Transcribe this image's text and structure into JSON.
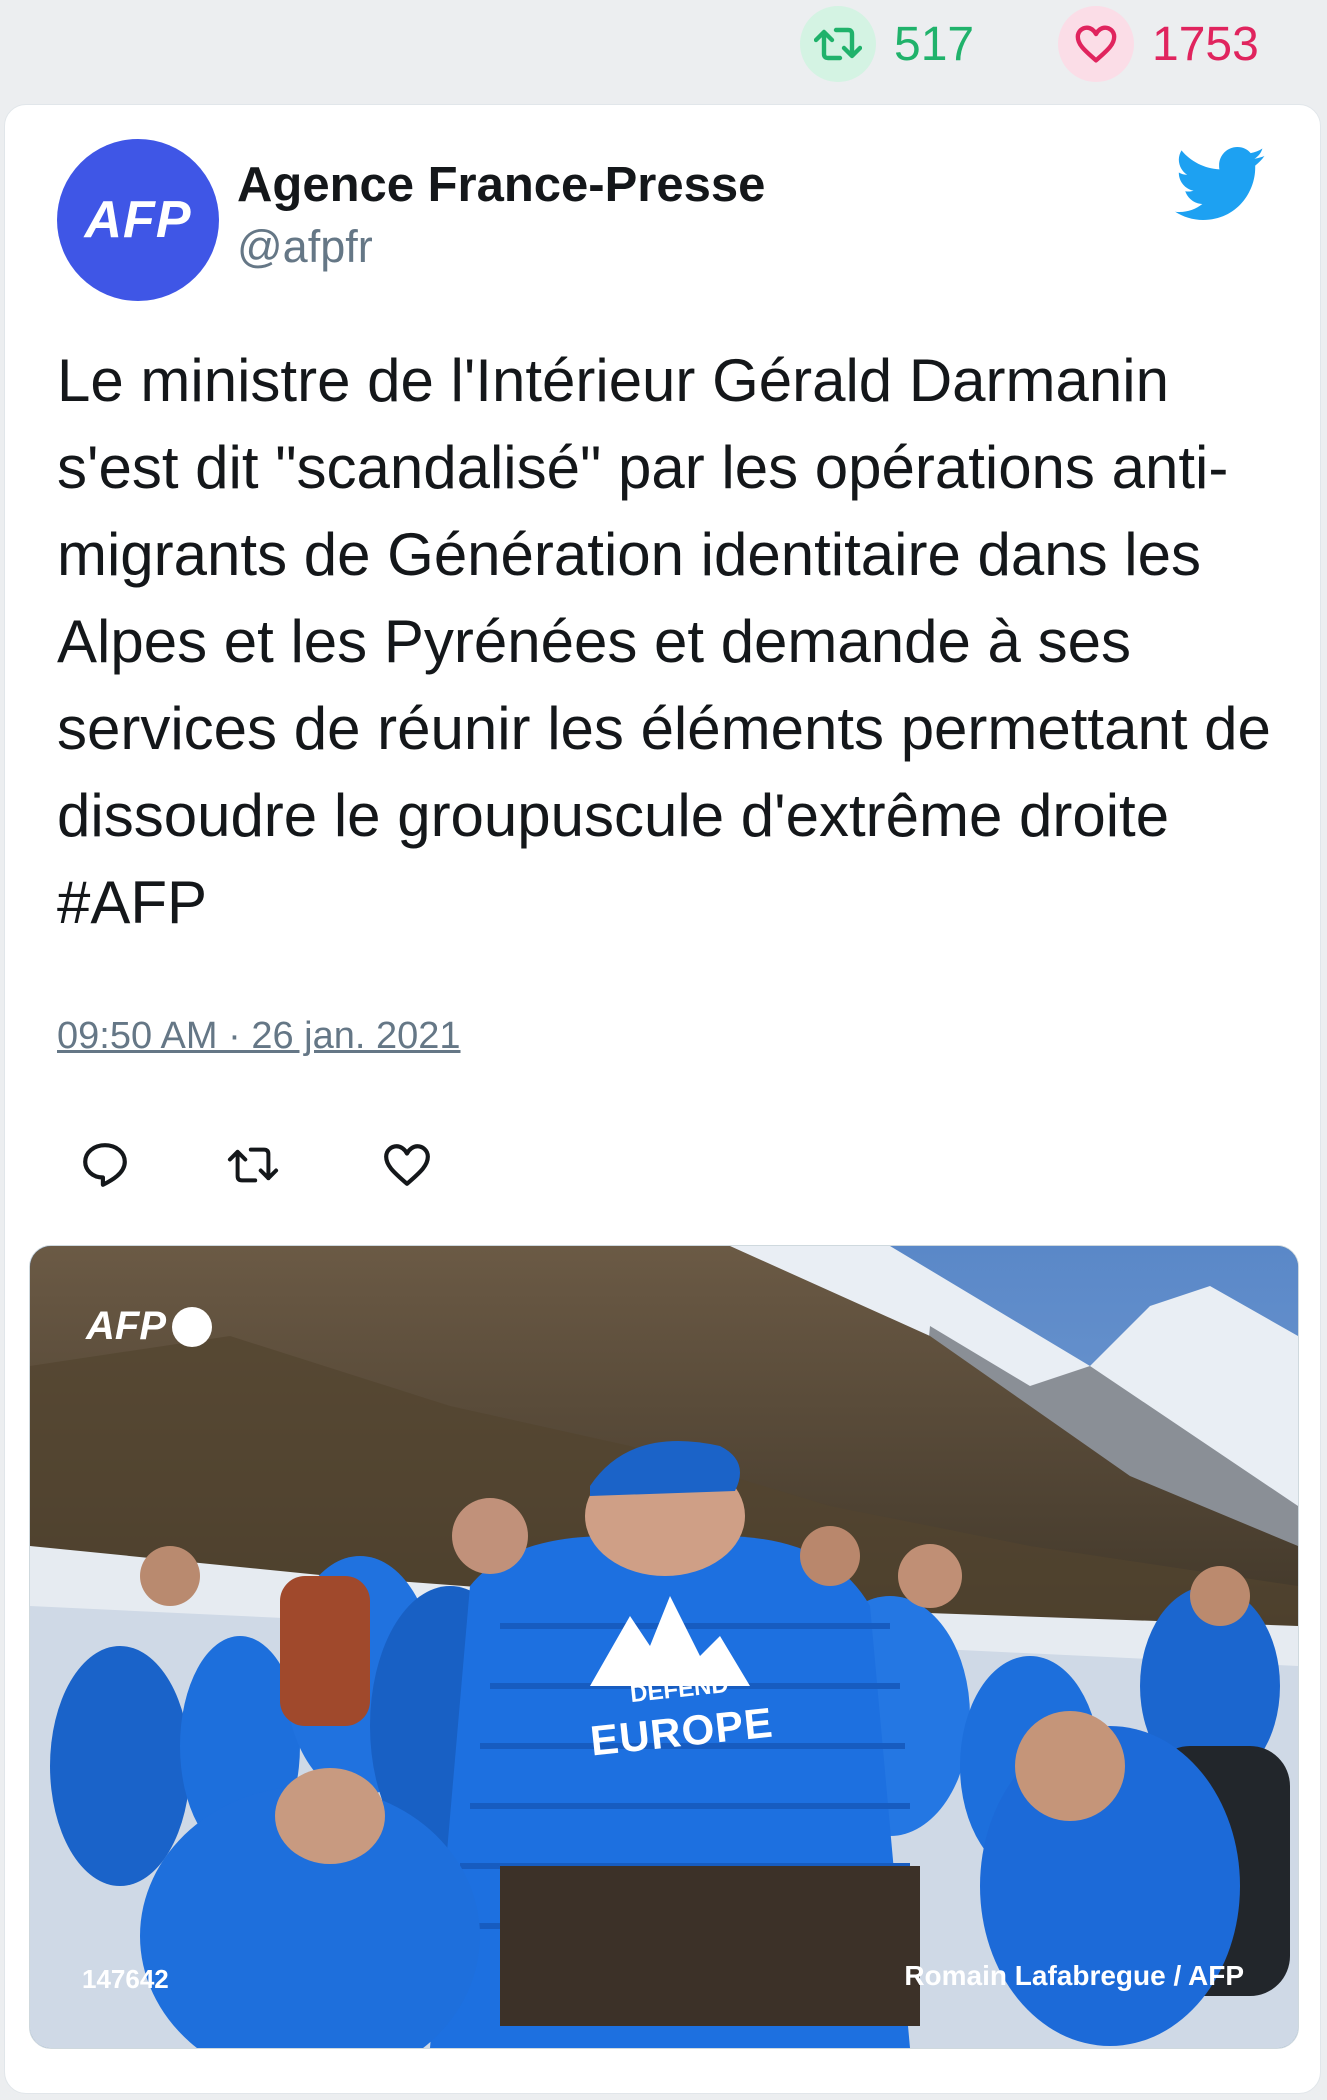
{
  "stats": {
    "retweet_count": "517",
    "like_count": "1753",
    "retweet_icon": "retweet-icon",
    "like_icon": "heart-icon"
  },
  "author": {
    "avatar_text": "AFP",
    "name": "Agence France-Presse",
    "handle": "@afpfr"
  },
  "tweet": {
    "text": "Le ministre de l'Intérieur Gérald Darmanin s'est dit \"scandalisé\" par les opérations anti-migrants de Génération identitaire dans les Alpes et les Pyrénées et demande à ses services de réunir les éléments permettant de dissoudre le groupuscule d'extrême droite #AFP",
    "timestamp": "09:50 AM · 26 jan. 2021"
  },
  "actions": [
    "reply-icon",
    "retweet-icon",
    "heart-icon"
  ],
  "media": {
    "watermark": "AFP",
    "photo_id": "147642",
    "credit": "Romain Lafabregue / AFP",
    "jacket_label_top": "DEFEND",
    "jacket_label_main": "EUROPE"
  },
  "colors": {
    "retweet": "#20b26b",
    "like": "#e0245e",
    "twitter_blue": "#1da1f2",
    "avatar_bg": "#3f56e6"
  }
}
